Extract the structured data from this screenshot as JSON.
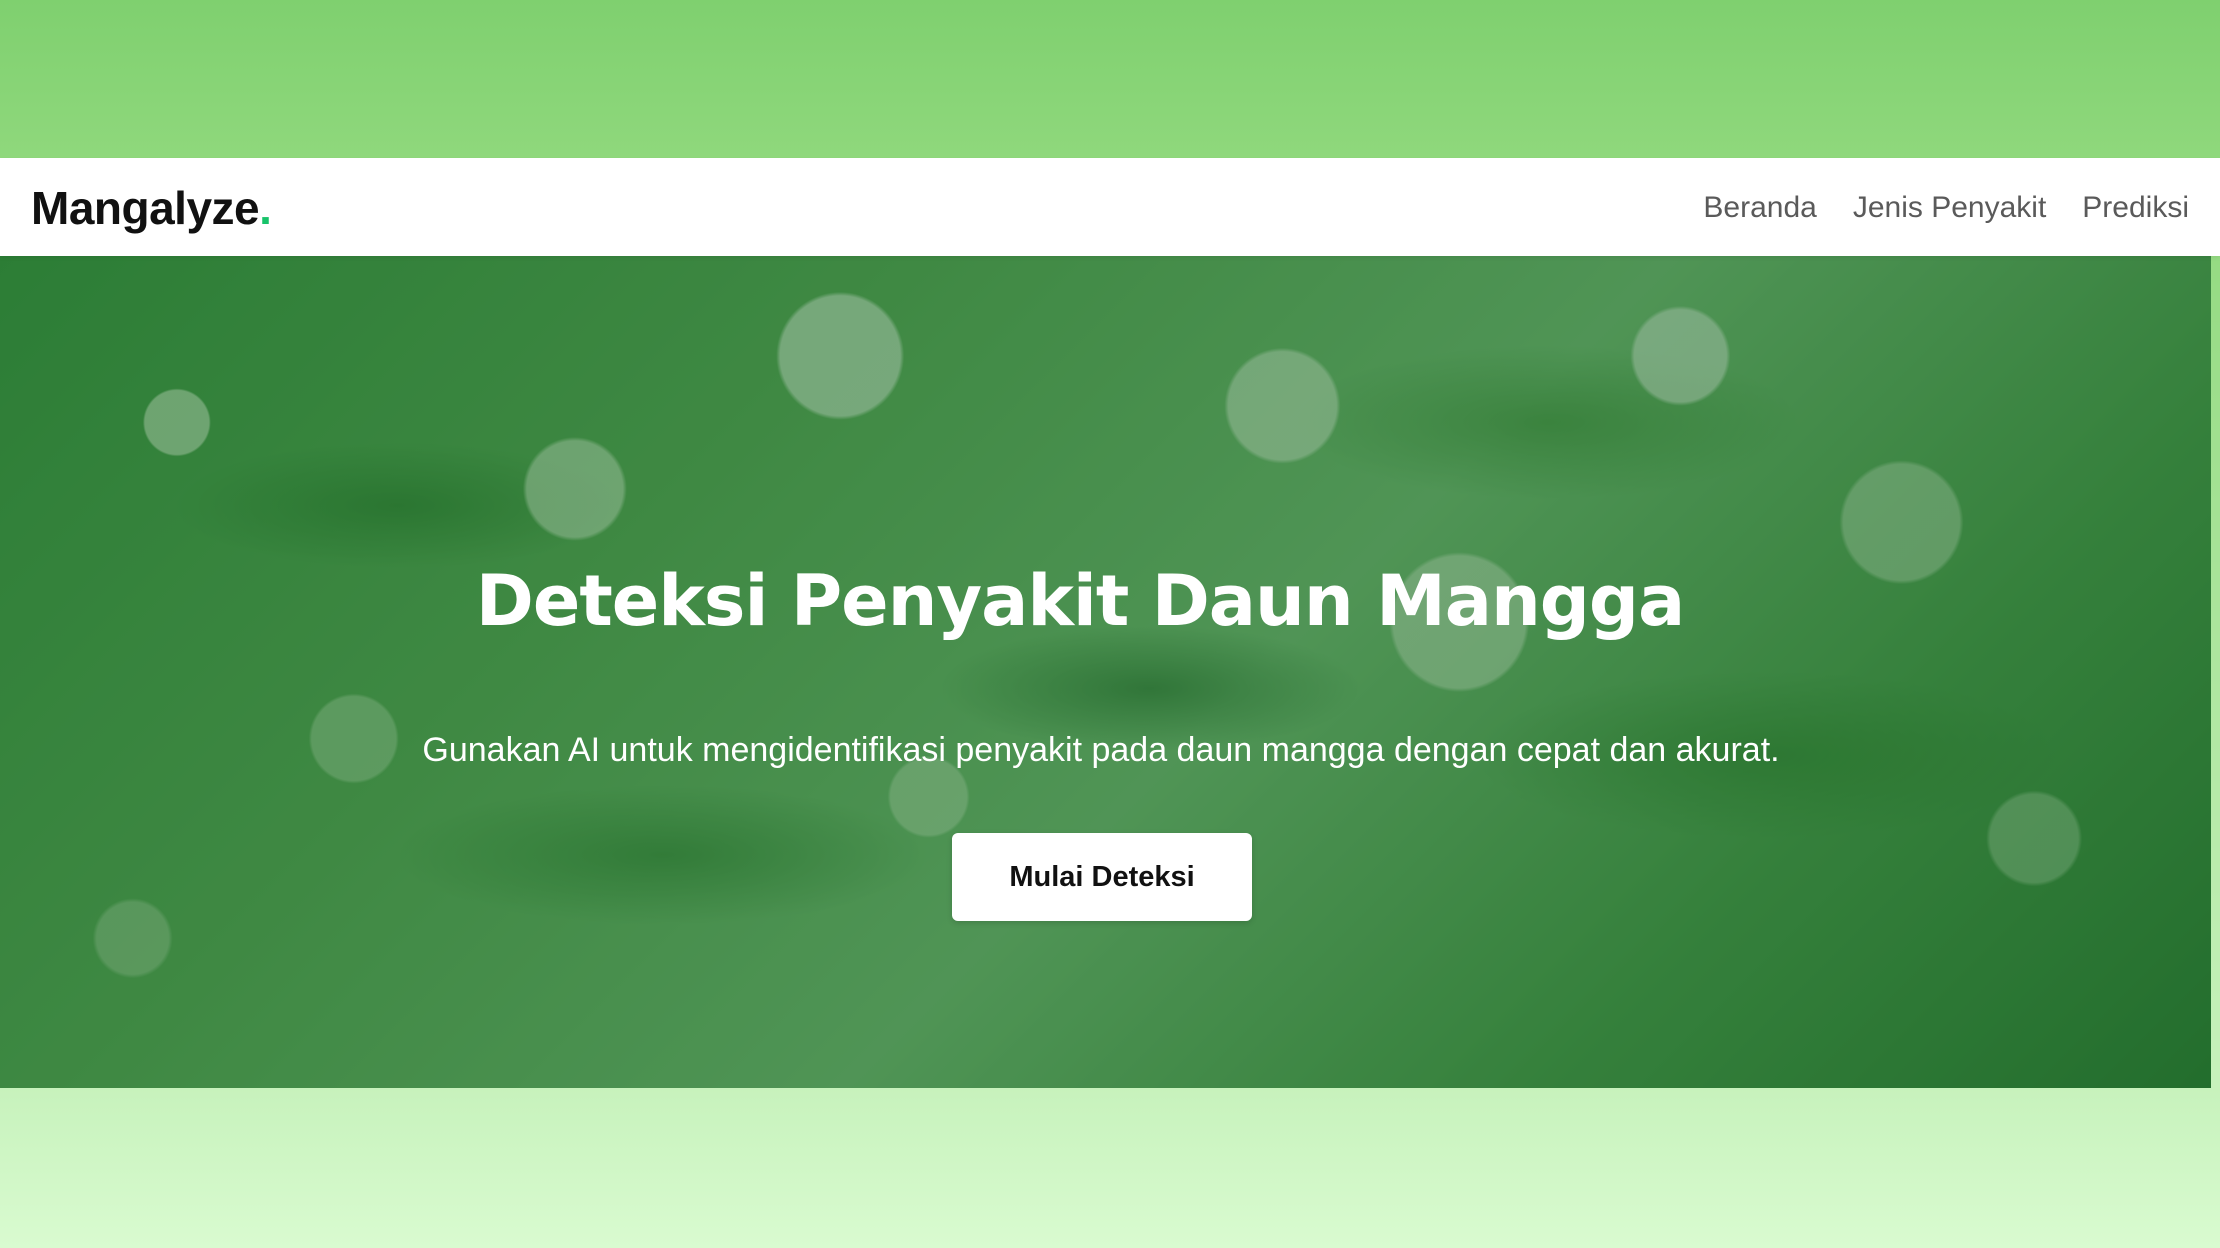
{
  "navbar": {
    "logo_text": "Mangalyze",
    "logo_dot": ".",
    "links": [
      {
        "label": "Beranda"
      },
      {
        "label": "Jenis Penyakit"
      },
      {
        "label": "Prediksi"
      }
    ]
  },
  "hero": {
    "title": "Deteksi Penyakit Daun Mangga",
    "subtitle": "Gunakan AI untuk mengidentifikasi penyakit pada daun mangga dengan cepat dan akurat.",
    "cta_label": "Mulai Deteksi",
    "background_image": "mango-leaves-photo"
  },
  "colors": {
    "accent": "#18c36a",
    "page_background_top": "#7fd06f",
    "page_background_bottom": "#d9fbd0",
    "hero_overlay": "#145523"
  }
}
